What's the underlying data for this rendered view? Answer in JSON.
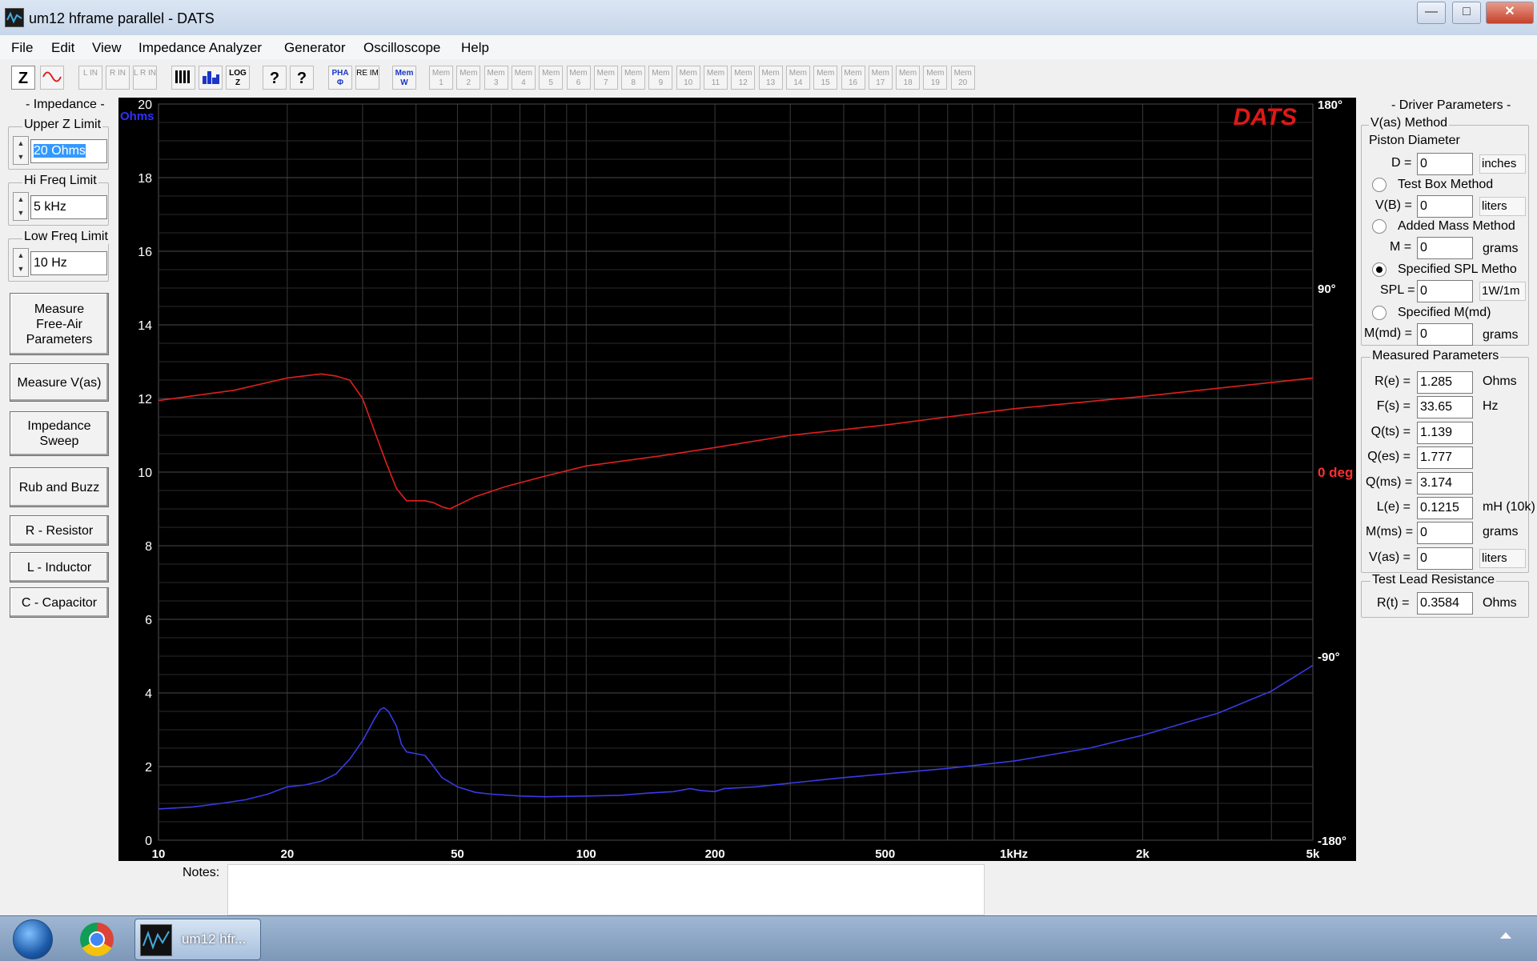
{
  "window": {
    "title": "um12 hframe parallel - DATS"
  },
  "menu": [
    "File",
    "Edit",
    "View",
    "Impedance Analyzer",
    "Generator",
    "Oscilloscope",
    "Help"
  ],
  "toolbar": {
    "z_label": "Z",
    "tools": [
      "L IN",
      "R IN",
      "L R IN"
    ],
    "log_label": "LOG Z",
    "help_labels": [
      "?",
      "?"
    ],
    "pha_label": "PHA Φ",
    "reim_label": "RE IM",
    "memw_label": "Mem W",
    "mem_labels": [
      "Mem 1",
      "Mem 2",
      "Mem 3",
      "Mem 4",
      "Mem 5",
      "Mem 6",
      "Mem 7",
      "Mem 8",
      "Mem 9",
      "Mem 10",
      "Mem 11",
      "Mem 12",
      "Mem 13",
      "Mem 14",
      "Mem 15",
      "Mem 16",
      "Mem 17",
      "Mem 18",
      "Mem 19",
      "Mem 20"
    ]
  },
  "left": {
    "group_title": "- Impedance -",
    "upper_z_label": "Upper Z Limit",
    "upper_z_value": "20 Ohms",
    "hi_freq_label": "Hi Freq Limit",
    "hi_freq_value": "5 kHz",
    "low_freq_label": "Low Freq Limit",
    "low_freq_value": "10 Hz",
    "buttons": [
      "Measure Free-Air Parameters",
      "Measure V(as)",
      "Impedance Sweep",
      "Rub and Buzz",
      "R - Resistor",
      "L - Inductor",
      "C - Capacitor"
    ]
  },
  "chart_data": {
    "type": "line",
    "logo": "DATS",
    "left_unit": "Ohms",
    "right_unit": "deg",
    "xscale": "log",
    "xlim": [
      10,
      5000
    ],
    "ylim": [
      0,
      20
    ],
    "phase_lim": [
      -180,
      180
    ],
    "x_ticks": [
      10,
      20,
      50,
      100,
      200,
      500,
      1000,
      2000,
      5000
    ],
    "x_tick_labels": [
      "10",
      "20",
      "50",
      "100",
      "200",
      "500",
      "1kHz",
      "2k",
      "5k"
    ],
    "y_ticks": [
      0,
      2,
      4,
      6,
      8,
      10,
      12,
      14,
      16,
      18,
      20
    ],
    "y_tick_labels": [
      "0",
      "2",
      "4",
      "6",
      "8",
      "10",
      "12",
      "14",
      "16",
      "18",
      "20"
    ],
    "phase_ticks": [
      180,
      90,
      0,
      -90,
      -180
    ],
    "phase_tick_labels": [
      "180°",
      "90°",
      "0 deg",
      "-90°",
      "-180°"
    ],
    "grid": true,
    "series": [
      {
        "color": "#3a3ae6",
        "points": [
          [
            10,
            0.85
          ],
          [
            12,
            0.9
          ],
          [
            14,
            1.0
          ],
          [
            16,
            1.1
          ],
          [
            18,
            1.25
          ],
          [
            20,
            1.45
          ],
          [
            22,
            1.5
          ],
          [
            24,
            1.6
          ],
          [
            26,
            1.8
          ],
          [
            28,
            2.2
          ],
          [
            30,
            2.7
          ],
          [
            31,
            3.0
          ],
          [
            32,
            3.3
          ],
          [
            33,
            3.55
          ],
          [
            33.65,
            3.6
          ],
          [
            34.5,
            3.5
          ],
          [
            36,
            3.1
          ],
          [
            37,
            2.6
          ],
          [
            38,
            2.4
          ],
          [
            40,
            2.35
          ],
          [
            42,
            2.3
          ],
          [
            44,
            2.0
          ],
          [
            46,
            1.7
          ],
          [
            50,
            1.45
          ],
          [
            55,
            1.3
          ],
          [
            60,
            1.25
          ],
          [
            70,
            1.2
          ],
          [
            80,
            1.18
          ],
          [
            100,
            1.2
          ],
          [
            120,
            1.22
          ],
          [
            140,
            1.28
          ],
          [
            160,
            1.32
          ],
          [
            175,
            1.4
          ],
          [
            185,
            1.35
          ],
          [
            200,
            1.32
          ],
          [
            210,
            1.4
          ],
          [
            250,
            1.45
          ],
          [
            300,
            1.55
          ],
          [
            400,
            1.7
          ],
          [
            500,
            1.8
          ],
          [
            700,
            1.95
          ],
          [
            1000,
            2.15
          ],
          [
            1500,
            2.5
          ],
          [
            2000,
            2.85
          ],
          [
            3000,
            3.45
          ],
          [
            4000,
            4.05
          ],
          [
            5000,
            4.75
          ]
        ]
      },
      {
        "color": "#e02020",
        "phase_points": [
          [
            10,
            35
          ],
          [
            15,
            40
          ],
          [
            20,
            46
          ],
          [
            24,
            48
          ],
          [
            26,
            47
          ],
          [
            28,
            45
          ],
          [
            30,
            36
          ],
          [
            32,
            20
          ],
          [
            34,
            5
          ],
          [
            36,
            -8
          ],
          [
            38,
            -14
          ],
          [
            42,
            -14
          ],
          [
            44,
            -15
          ],
          [
            46,
            -17
          ],
          [
            48,
            -18
          ],
          [
            55,
            -12
          ],
          [
            65,
            -7
          ],
          [
            80,
            -2
          ],
          [
            100,
            3
          ],
          [
            150,
            8
          ],
          [
            200,
            12
          ],
          [
            300,
            18
          ],
          [
            500,
            23
          ],
          [
            700,
            27
          ],
          [
            1000,
            31
          ],
          [
            2000,
            37
          ],
          [
            3000,
            41
          ],
          [
            5000,
            46
          ]
        ]
      }
    ]
  },
  "right": {
    "driver_title": "- Driver Parameters -",
    "vas_method": "V(as) Method",
    "piston_diameter": "Piston Diameter",
    "d_label": "D =",
    "d_value": "0",
    "d_unit": "inches",
    "test_box": "Test Box Method",
    "vb_label": "V(B) =",
    "vb_value": "0",
    "vb_unit": "liters",
    "added_mass": "Added Mass Method",
    "m_label": "M =",
    "m_value": "0",
    "m_unit": "grams",
    "specified_spl": "Specified SPL Metho",
    "spl_label": "SPL =",
    "spl_value": "0",
    "spl_unit": "1W/1m",
    "specified_mmd": "Specified M(md)",
    "mmd_label": "M(md) =",
    "mmd_value": "0",
    "mmd_unit": "grams",
    "measured_title": "Measured Parameters",
    "measured": [
      {
        "label": "R(e) =",
        "value": "1.285",
        "unit": "Ohms"
      },
      {
        "label": "F(s) =",
        "value": "33.65",
        "unit": "Hz"
      },
      {
        "label": "Q(ts) =",
        "value": "1.139",
        "unit": ""
      },
      {
        "label": "Q(es) =",
        "value": "1.777",
        "unit": ""
      },
      {
        "label": "Q(ms) =",
        "value": "3.174",
        "unit": ""
      },
      {
        "label": "L(e) =",
        "value": "0.1215",
        "unit": "mH (10k)"
      },
      {
        "label": "M(ms) =",
        "value": "0",
        "unit": "grams"
      },
      {
        "label": "V(as) =",
        "value": "0",
        "unit": "liters"
      }
    ],
    "lead_title": "Test Lead Resistance",
    "rt_label": "R(t) =",
    "rt_value": "0.3584",
    "rt_unit": "Ohms"
  },
  "notes": {
    "label": "Notes:"
  },
  "taskbar": {
    "item_label": "um12 hfr..."
  }
}
